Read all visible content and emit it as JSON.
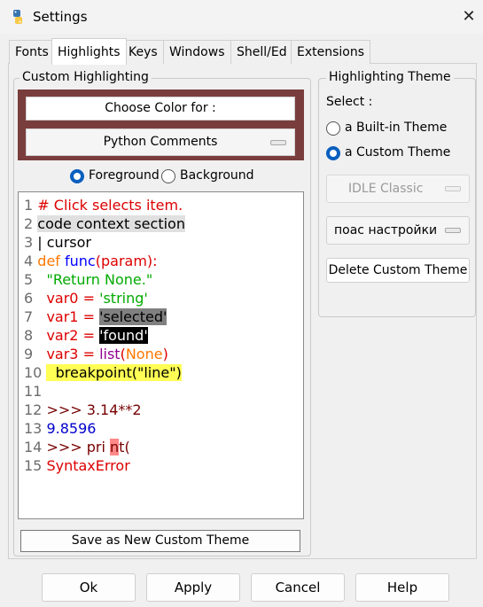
{
  "window": {
    "title": "Settings",
    "close_label": "✕",
    "icon": "python-icon"
  },
  "tabs": [
    "Fonts",
    "Highlights",
    "Keys",
    "Windows",
    "Shell/Ed",
    "Extensions"
  ],
  "active_tab": "Highlights",
  "custom_highlighting": {
    "label": "Custom Highlighting",
    "choose_color_label": "Choose Color for :",
    "element_selected": "Python Comments",
    "foreground_label": "Foreground",
    "background_label": "Background",
    "selected_radio": "Foreground",
    "sample_color": "#7a3d3d"
  },
  "sample": {
    "lines": [
      {
        "n": "1",
        "parts": [
          {
            "t": "# Click selects item.",
            "c": "#dd0000"
          }
        ]
      },
      {
        "n": "2",
        "parts": [
          {
            "t": "code context section",
            "c": "#000000",
            "bg": "#e0e0e0"
          }
        ]
      },
      {
        "n": "3",
        "parts": [
          {
            "t": "| cursor",
            "c": "#000000"
          }
        ]
      },
      {
        "n": "4",
        "parts": [
          {
            "t": "def",
            "c": "#ff7700"
          },
          {
            "t": " ",
            "c": "#000000"
          },
          {
            "t": "func",
            "c": "#0000ff"
          },
          {
            "t": "(param):",
            "c": "#dd0000"
          }
        ]
      },
      {
        "n": "5",
        "parts": [
          {
            "t": "  ",
            "c": "#000000"
          },
          {
            "t": "\"Return None.\"",
            "c": "#00aa00"
          }
        ]
      },
      {
        "n": "6",
        "parts": [
          {
            "t": "  var0 = ",
            "c": "#dd0000"
          },
          {
            "t": "'string'",
            "c": "#00aa00"
          }
        ]
      },
      {
        "n": "7",
        "parts": [
          {
            "t": "  var1 = ",
            "c": "#dd0000"
          },
          {
            "t": "'selected'",
            "c": "#000000",
            "bg": "#808080"
          }
        ]
      },
      {
        "n": "8",
        "parts": [
          {
            "t": "  var2 = ",
            "c": "#dd0000"
          },
          {
            "t": "'found'",
            "c": "#ffffff",
            "bg": "#000000"
          }
        ]
      },
      {
        "n": "9",
        "parts": [
          {
            "t": "  var3 = ",
            "c": "#dd0000"
          },
          {
            "t": "list",
            "c": "#900090"
          },
          {
            "t": "(",
            "c": "#dd0000"
          },
          {
            "t": "None",
            "c": "#ff7700"
          },
          {
            "t": ")",
            "c": "#dd0000"
          }
        ]
      },
      {
        "n": "10",
        "parts": [
          {
            "t": "  breakpoint(\"line\")",
            "c": "#000000",
            "bg": "#ffff55"
          }
        ]
      },
      {
        "n": "11",
        "parts": []
      },
      {
        "n": "12",
        "parts": [
          {
            "t": ">>> 3.14**2",
            "c": "#770000"
          }
        ]
      },
      {
        "n": "13",
        "parts": [
          {
            "t": "9.8596",
            "c": "#0000cc"
          }
        ]
      },
      {
        "n": "14",
        "parts": [
          {
            "t": ">>> pri ",
            "c": "#770000"
          },
          {
            "t": "n",
            "c": "#770000",
            "bg": "#ff8888"
          },
          {
            "t": "t(",
            "c": "#770000"
          }
        ]
      },
      {
        "n": "15",
        "parts": [
          {
            "t": "SyntaxError",
            "c": "#dd0000"
          }
        ]
      }
    ]
  },
  "save_theme_label": "Save as New Custom Theme",
  "highlighting_theme": {
    "label": "Highlighting Theme",
    "select_label": "Select :",
    "builtin_label": "a Built-in Theme",
    "custom_label": "a Custom Theme",
    "selected": "a Custom Theme",
    "builtin_value": "IDLE Classic",
    "custom_value": "поас настройки",
    "delete_label": "Delete Custom Theme"
  },
  "buttons": {
    "ok": "Ok",
    "apply": "Apply",
    "cancel": "Cancel",
    "help": "Help"
  },
  "accent": "#0a5fbf"
}
